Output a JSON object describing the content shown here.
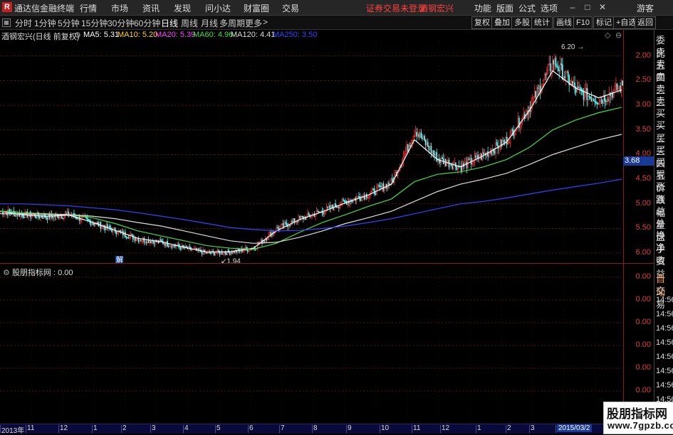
{
  "app": {
    "logo": "R",
    "title": "通达信金融终端"
  },
  "menu": [
    "行情",
    "市场",
    "资讯",
    "发现",
    "问小达",
    "财富圈",
    "交易"
  ],
  "status": {
    "trade_notice": "证券交易未登录",
    "stock_name": "酒钢宏兴"
  },
  "right_menu": [
    "功能",
    "版面",
    "公式",
    "选项"
  ],
  "guest": "游客",
  "periods": [
    "分时",
    "1分钟",
    "5分钟",
    "15分钟",
    "30分钟",
    "60分钟",
    "日线",
    "周线",
    "月线",
    "多周期",
    "更多"
  ],
  "active_period": "日线",
  "toolbar": [
    "复权",
    "叠加",
    "多股",
    "统计",
    "画线",
    "F10",
    "标记",
    "+自选",
    "返回"
  ],
  "chart_info": {
    "label": "酒钢宏兴(日线 前复权)",
    "ma": [
      {
        "name": "MA5",
        "value": "5.31",
        "color": "#ffffff"
      },
      {
        "name": "MA10",
        "value": "5.20",
        "color": "#ffd700"
      },
      {
        "name": "MA20",
        "value": "5.39",
        "color": "#ff44ff"
      },
      {
        "name": "MA60",
        "value": "4.96",
        "color": "#44dd44"
      },
      {
        "name": "MA120",
        "value": "4.41",
        "color": "#dddddd"
      },
      {
        "name": "MA250",
        "value": "3.50",
        "color": "#3344ff"
      }
    ]
  },
  "sub_label": "股朋指标网 : 0.00",
  "sidebar": [
    "委比",
    "卖五",
    "卖四",
    "卖三",
    "卖二",
    "卖一",
    "买一",
    "买二",
    "买三",
    "买四",
    "买五",
    "现价",
    "涨跌",
    "涨幅",
    "总量",
    "外盘",
    "换手",
    "净资",
    "收益"
  ],
  "sidebar2": [
    "自动",
    "交易"
  ],
  "sub_times": [
    "14:56",
    "14:56",
    "14:56",
    "14:56",
    "14:56",
    "14:56",
    "14:56",
    "14:56",
    "14:56"
  ],
  "marker": {
    "high_label": "6.20",
    "low_label": "1.94",
    "current_price": "3.68",
    "tag": "解"
  },
  "y_ticks": [
    "6.00",
    "5.50",
    "5.00",
    "4.50",
    "4.00",
    "3.50",
    "3.00",
    "2.50",
    "2.00"
  ],
  "sub_ticks": [
    "0.00",
    "0.00",
    "0.00",
    "0.00",
    "0.00",
    "0.00"
  ],
  "x_ticks": [
    "2013年",
    "11",
    "12",
    "1",
    "2",
    "3",
    "4",
    "5",
    "6",
    "7",
    "8",
    "9",
    "10",
    "11",
    "12",
    "1",
    "2",
    "3",
    "2015/03/2"
  ],
  "watermark": {
    "title": "股朋指标网",
    "url": "www.7gpzb.com"
  },
  "chart_data": {
    "type": "candlestick",
    "title": "酒钢宏兴(日线 前复权)",
    "ylim": [
      1.8,
      6.3
    ],
    "y_ticks": [
      2.0,
      2.5,
      3.0,
      3.5,
      4.0,
      4.5,
      5.0,
      5.5,
      6.0
    ],
    "high": 6.2,
    "low": 1.94,
    "current": 3.68,
    "close_path": [
      2.85,
      2.78,
      2.74,
      2.78,
      2.62,
      2.45,
      2.28,
      2.22,
      2.1,
      2.0,
      2.02,
      2.1,
      2.5,
      2.7,
      2.85,
      3.05,
      3.2,
      3.45,
      4.5,
      3.9,
      3.75,
      4.0,
      4.3,
      5.0,
      5.9,
      5.3,
      5.1,
      5.4
    ],
    "series": [
      {
        "name": "MA5",
        "values": [
          2.85,
          2.78,
          2.75,
          2.77,
          2.63,
          2.46,
          2.3,
          2.23,
          2.12,
          2.02,
          2.03,
          2.1,
          2.45,
          2.68,
          2.84,
          3.02,
          3.18,
          3.4,
          4.3,
          3.9,
          3.75,
          3.98,
          4.25,
          4.9,
          5.7,
          5.35,
          5.15,
          5.31
        ]
      },
      {
        "name": "MA60",
        "values": [
          2.85,
          2.82,
          2.8,
          2.78,
          2.72,
          2.6,
          2.45,
          2.35,
          2.25,
          2.15,
          2.1,
          2.08,
          2.2,
          2.42,
          2.62,
          2.78,
          2.95,
          3.1,
          3.45,
          3.6,
          3.65,
          3.75,
          3.9,
          4.15,
          4.5,
          4.7,
          4.85,
          4.96
        ]
      },
      {
        "name": "MA120",
        "values": [
          2.8,
          2.8,
          2.79,
          2.78,
          2.75,
          2.7,
          2.62,
          2.55,
          2.45,
          2.35,
          2.25,
          2.2,
          2.22,
          2.32,
          2.45,
          2.6,
          2.72,
          2.85,
          3.05,
          3.25,
          3.4,
          3.5,
          3.62,
          3.8,
          4.0,
          4.15,
          4.3,
          4.41
        ]
      },
      {
        "name": "MA250",
        "values": [
          3.0,
          3.0,
          2.98,
          2.96,
          2.92,
          2.88,
          2.82,
          2.75,
          2.68,
          2.6,
          2.52,
          2.48,
          2.45,
          2.46,
          2.5,
          2.55,
          2.62,
          2.7,
          2.8,
          2.9,
          3.0,
          3.05,
          3.12,
          3.2,
          3.28,
          3.35,
          3.42,
          3.5
        ]
      }
    ]
  }
}
